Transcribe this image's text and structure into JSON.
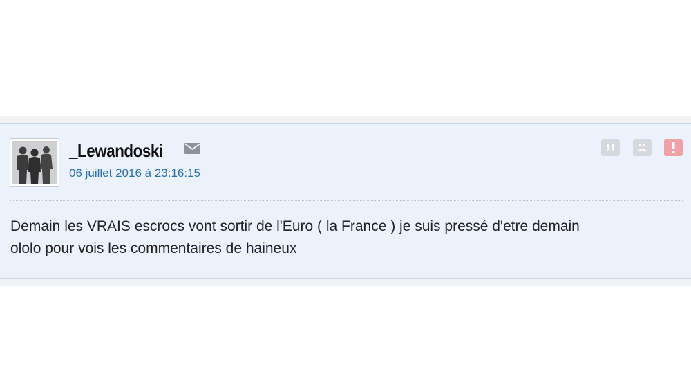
{
  "post": {
    "author": "_Lewandoski",
    "date": "06 juillet 2016 à 23:16:15",
    "message_lines": [
      "Demain les VRAIS escrocs vont sortir de l'Euro ( la France ) je suis pressé d'etre demain",
      "ololo pour vois les commentaires de haineux"
    ],
    "icons": {
      "avatar": "avatar-silhouettes",
      "mail": "mail-icon",
      "quote": "quote-icon",
      "sad": "sad-face-icon",
      "alert": "alert-icon"
    }
  },
  "colors": {
    "post_background": "#ebf2fb",
    "date_link": "#2a6fb0",
    "alert_badge": "#f0a1a6",
    "neutral_badge": "#d5d8dc"
  }
}
